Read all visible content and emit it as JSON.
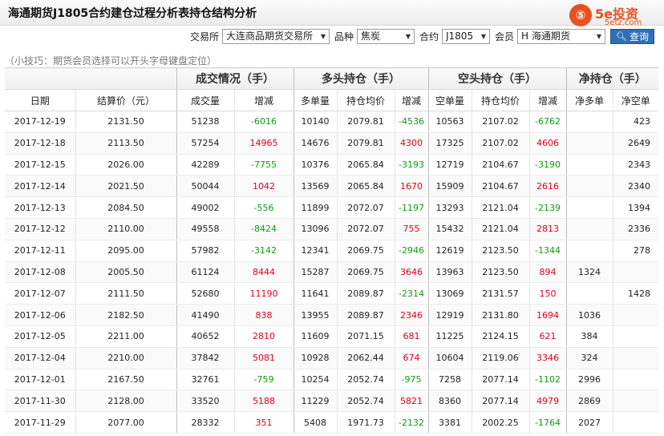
{
  "title": "海通期货J1805合约建仓过程分析表持仓结构分析",
  "watermark": {
    "glyph": "⑤",
    "brand": "5e投资",
    "url": "5etz.com"
  },
  "filters": {
    "exchange_label": "交易所",
    "exchange_value": "大连商品期货交易所",
    "variety_label": "品种",
    "variety_value": "焦炭",
    "contract_label": "合约",
    "contract_value": "J1805",
    "member_label": "会员",
    "member_value": "H 海通期货",
    "query_label": "查询"
  },
  "tip": "（小技巧：期货会员选择可以开头字母键盘定位）",
  "table": {
    "group_headers": [
      "成交情况（手）",
      "多头持仓（手）",
      "空头持仓（手）",
      "净持仓（手）"
    ],
    "columns": [
      "日期",
      "结算价（元）",
      "成交量",
      "增减",
      "多单量",
      "持仓均价",
      "增减",
      "空单量",
      "持仓均价",
      "增减",
      "净多单",
      "净空单"
    ],
    "rows": [
      [
        "2017-12-19",
        "2131.50",
        "51238",
        "-6016",
        "10140",
        "2079.81",
        "-4536",
        "10563",
        "2107.02",
        "-6762",
        "",
        "423"
      ],
      [
        "2017-12-18",
        "2113.50",
        "57254",
        "14965",
        "14676",
        "2079.81",
        "4300",
        "17325",
        "2107.02",
        "4606",
        "",
        "2649"
      ],
      [
        "2017-12-15",
        "2026.00",
        "42289",
        "-7755",
        "10376",
        "2065.84",
        "-3193",
        "12719",
        "2104.67",
        "-3190",
        "",
        "2343"
      ],
      [
        "2017-12-14",
        "2021.50",
        "50044",
        "1042",
        "13569",
        "2065.84",
        "1670",
        "15909",
        "2104.67",
        "2616",
        "",
        "2340"
      ],
      [
        "2017-12-13",
        "2084.50",
        "49002",
        "-556",
        "11899",
        "2072.07",
        "-1197",
        "13293",
        "2121.04",
        "-2139",
        "",
        "1394"
      ],
      [
        "2017-12-12",
        "2110.00",
        "49558",
        "-8424",
        "13096",
        "2072.07",
        "755",
        "15432",
        "2121.04",
        "2813",
        "",
        "2336"
      ],
      [
        "2017-12-11",
        "2095.00",
        "57982",
        "-3142",
        "12341",
        "2069.75",
        "-2946",
        "12619",
        "2123.50",
        "-1344",
        "",
        "278"
      ],
      [
        "2017-12-08",
        "2005.50",
        "61124",
        "8444",
        "15287",
        "2069.75",
        "3646",
        "13963",
        "2123.50",
        "894",
        "1324",
        ""
      ],
      [
        "2017-12-07",
        "2111.50",
        "52680",
        "11190",
        "11641",
        "2089.87",
        "-2314",
        "13069",
        "2131.57",
        "150",
        "",
        "1428"
      ],
      [
        "2017-12-06",
        "2182.50",
        "41490",
        "838",
        "13955",
        "2089.87",
        "2346",
        "12919",
        "2131.80",
        "1694",
        "1036",
        ""
      ],
      [
        "2017-12-05",
        "2211.00",
        "40652",
        "2810",
        "11609",
        "2071.15",
        "681",
        "11225",
        "2124.15",
        "621",
        "384",
        ""
      ],
      [
        "2017-12-04",
        "2210.00",
        "37842",
        "5081",
        "10928",
        "2062.44",
        "674",
        "10604",
        "2119.06",
        "3346",
        "324",
        ""
      ],
      [
        "2017-12-01",
        "2167.50",
        "32761",
        "-759",
        "10254",
        "2052.74",
        "-975",
        "7258",
        "2077.14",
        "-1102",
        "2996",
        ""
      ],
      [
        "2017-11-30",
        "2128.00",
        "33520",
        "5188",
        "11229",
        "2052.74",
        "5821",
        "8360",
        "2077.14",
        "4979",
        "2869",
        ""
      ],
      [
        "2017-11-29",
        "2077.00",
        "28332",
        "351",
        "5408",
        "1971.73",
        "-2132",
        "3381",
        "2002.25",
        "-1764",
        "2027",
        ""
      ]
    ]
  },
  "colors": {
    "increase": "#e0001a",
    "decrease": "#129a12",
    "accent": "#2f6fb7",
    "brand": "#e8501f"
  }
}
